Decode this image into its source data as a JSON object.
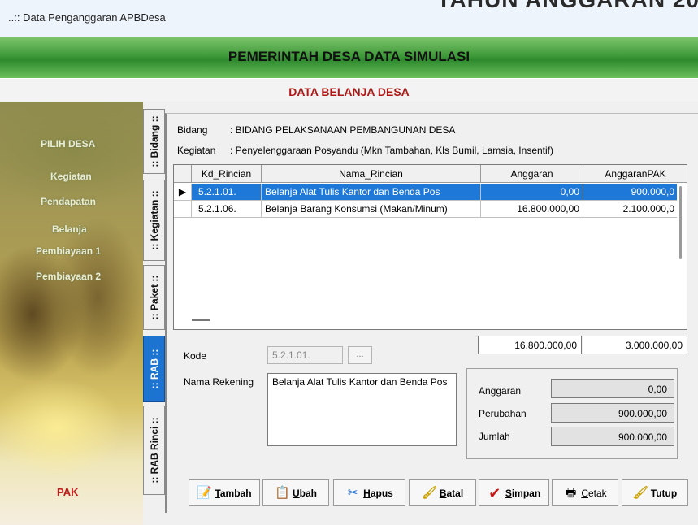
{
  "window": {
    "title": "..:: Data Penganggaran APBDesa",
    "background_heading": "TAHUN ANGGARAN 20"
  },
  "header": {
    "title": "PEMERINTAH DESA DATA SIMULASI",
    "subtitle": "DATA BELANJA DESA"
  },
  "sidebar": {
    "items": [
      {
        "label": "PILIH DESA"
      },
      {
        "label": "Kegiatan"
      },
      {
        "label": "Pendapatan"
      },
      {
        "label": "Belanja"
      },
      {
        "label": "Pembiayaan 1"
      },
      {
        "label": "Pembiayaan 2"
      }
    ],
    "footer_label": "PAK"
  },
  "tabs": [
    {
      "label": ":: Bidang ::"
    },
    {
      "label": ":: Kegiatan ::"
    },
    {
      "label": ":: Paket ::"
    },
    {
      "label": ":: RAB ::"
    },
    {
      "label": ":: RAB Rinci ::"
    }
  ],
  "info": {
    "bidang_label": "Bidang",
    "bidang_value": ": BIDANG PELAKSANAAN PEMBANGUNAN DESA",
    "kegiatan_label": "Kegiatan",
    "kegiatan_value": ": Penyelenggaraan Posyandu (Mkn Tambahan, Kls Bumil, Lamsia, Insentif)"
  },
  "table": {
    "columns": [
      "Kd_Rincian",
      "Nama_Rincian",
      "Anggaran",
      "AnggaranPAK"
    ],
    "rows": [
      {
        "indicator": "▶",
        "kd": "5.2.1.01.",
        "nama": "Belanja Alat Tulis Kantor dan Benda Pos",
        "anggaran": "0,00",
        "anggaran_pak": "900.000,0"
      },
      {
        "indicator": "",
        "kd": "5.2.1.06.",
        "nama": "Belanja Barang Konsumsi (Makan/Minum)",
        "anggaran": "16.800.000,00",
        "anggaran_pak": "2.100.000,0"
      }
    ],
    "total_anggaran": "16.800.000,00",
    "total_anggaran_pak": "3.000.000,00"
  },
  "form": {
    "kode_label": "Kode",
    "kode_value": "5.2.1.01.",
    "ellipsis_label": "...",
    "nama_rekening_label": "Nama Rekening",
    "nama_rekening_value": "Belanja Alat Tulis Kantor dan Benda Pos"
  },
  "summary": {
    "anggaran_label": "Anggaran",
    "anggaran_value": "0,00",
    "perubahan_label": "Perubahan",
    "perubahan_value": "900.000,00",
    "jumlah_label": "Jumlah",
    "jumlah_value": "900.000,00"
  },
  "buttons": {
    "tambah": {
      "mnemonic": "T",
      "rest": "ambah",
      "icon": "add-document-icon"
    },
    "ubah": {
      "mnemonic": "U",
      "rest": "bah",
      "icon": "edit-document-icon"
    },
    "hapus": {
      "mnemonic": "H",
      "rest": "apus",
      "icon": "delete-icon"
    },
    "batal": {
      "mnemonic": "B",
      "rest": "atal",
      "icon": "cancel-brush-icon"
    },
    "simpan": {
      "mnemonic": "S",
      "rest": "impan",
      "icon": "checkmark-icon"
    },
    "cetak": {
      "mnemonic": "C",
      "rest": "etak",
      "icon": "printer-icon"
    },
    "tutup": {
      "mnemonic": "",
      "rest": "Tutup",
      "icon": "close-brush-icon"
    }
  },
  "colors": {
    "accent": "#1e78d8",
    "header_green": "#3f9a3a",
    "subtitle_red": "#b01818"
  }
}
